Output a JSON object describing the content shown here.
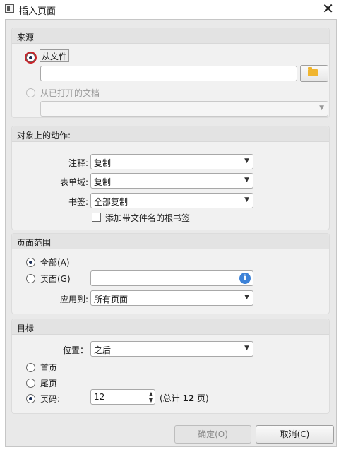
{
  "window": {
    "title": "插入页面",
    "close_glyph": "✕"
  },
  "source": {
    "title": "来源",
    "from_file_label": "从文件",
    "from_file_value": "",
    "from_open_label": "从已打开的文档",
    "from_open_value": ""
  },
  "actions": {
    "title": "对象上的动作:",
    "comments_label": "注释:",
    "comments_value": "复制",
    "forms_label": "表单域:",
    "forms_value": "复制",
    "bookmarks_label": "书签:",
    "bookmarks_value": "全部复制",
    "add_bookmark_label": "添加带文件名的根书签"
  },
  "range": {
    "title": "页面范围",
    "all_label": "全部(A)",
    "pages_label": "页面(G)",
    "pages_value": "",
    "apply_label": "应用到:",
    "apply_value": "所有页面"
  },
  "target": {
    "title": "目标",
    "position_label": "位置：",
    "position_value": "之后",
    "first_label": "首页",
    "last_label": "尾页",
    "page_label": "页码:",
    "page_value": "12",
    "total_prefix": "(总计 ",
    "total_pages": "12",
    "total_suffix": " 页)"
  },
  "buttons": {
    "ok": "确定(O)",
    "cancel": "取消(C)"
  },
  "icons": {
    "folder": "folder-open-icon",
    "info": "info-icon",
    "info_glyph": "i",
    "dropdown_glyph": "▼",
    "spin_up": "▲",
    "spin_down": "▼"
  },
  "colors": {
    "accent": "#c8242a",
    "info": "#3c82d8",
    "folder": "#f0b52f"
  }
}
